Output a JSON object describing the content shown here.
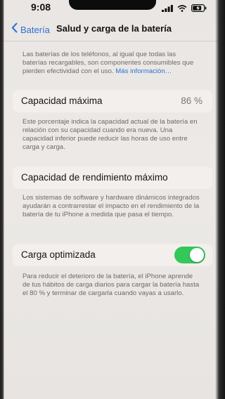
{
  "status_bar": {
    "time": "9:08",
    "icons": [
      "signal-icon",
      "wifi-icon",
      "battery-charging-icon"
    ]
  },
  "nav": {
    "back_label": "Batería",
    "title": "Salud y carga de la batería"
  },
  "intro": {
    "text": "Las baterías de los teléfonos, al igual que todas las baterías recargables, son componentes consumibles que pierden efectividad con el uso.",
    "link": "Más información…"
  },
  "max_capacity": {
    "label": "Capacidad máxima",
    "value": "86 %",
    "description": "Este porcentaje indica la capacidad actual de la batería en relación con su capacidad cuando era nueva. Una capacidad inferior puede reducir las horas de uso entre carga y carga."
  },
  "peak_performance": {
    "label": "Capacidad de rendimiento máximo",
    "description": "Los sistemas de software y hardware dinámicos integrados ayudarán a contrarrestar el impacto en el rendimiento de la batería de tu iPhone a medida que pasa el tiempo."
  },
  "optimized_charging": {
    "label": "Carga optimizada",
    "enabled": true,
    "description": "Para reducir el deterioro de la batería, el iPhone aprende de tus hábitos de carga diarios para cargar la batería hasta el 80 % y terminar de cargarla cuando vayas a usarlo."
  },
  "colors": {
    "accent": "#2f6fd6",
    "toggle_on": "#34c759",
    "background": "#e9e6e3",
    "cell": "#f2efec"
  }
}
